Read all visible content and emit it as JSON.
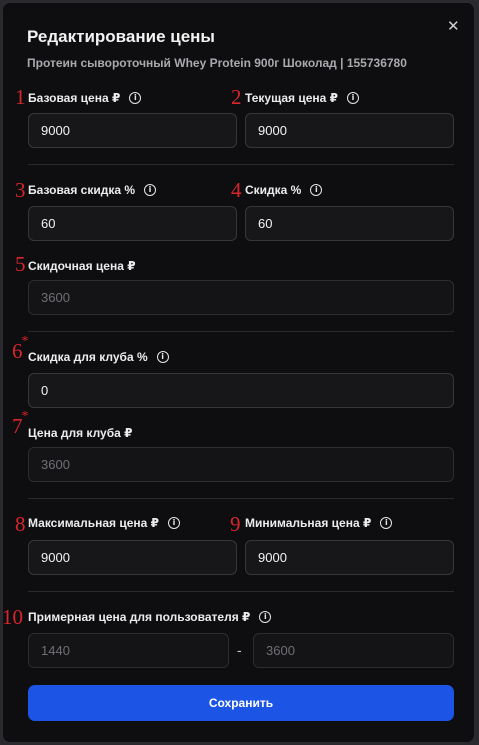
{
  "dialog": {
    "title": "Редактирование цены",
    "subtitle": "Протеин сывороточный Whey Protein 900г Шоколад | 155736780",
    "close_icon": "close-icon"
  },
  "fields": {
    "base_price": {
      "marker": "1",
      "label": "Базовая цена ₽",
      "value": "9000"
    },
    "current_price": {
      "marker": "2",
      "label": "Текущая цена ₽",
      "value": "9000"
    },
    "base_discount": {
      "marker": "3",
      "label": "Базовая скидка %",
      "value": "60"
    },
    "discount": {
      "marker": "4",
      "label": "Скидка %",
      "value": "60"
    },
    "discount_price": {
      "marker": "5",
      "label": "Скидочная цена ₽",
      "value": "3600"
    },
    "club_discount": {
      "marker": "6",
      "star": "*",
      "label": "Скидка для клуба %",
      "value": "0"
    },
    "club_price": {
      "marker": "7",
      "star": "*",
      "label": "Цена для клуба ₽",
      "value": "3600"
    },
    "max_price": {
      "marker": "8",
      "label": "Максимальная цена ₽",
      "value": "9000"
    },
    "min_price": {
      "marker": "9",
      "label": "Минимальная цена ₽",
      "value": "9000"
    },
    "user_price": {
      "marker": "10",
      "label": "Примерная цена для пользователя ₽",
      "from": "1440",
      "separator": "-",
      "to": "3600"
    }
  },
  "info_icon": "info-icon",
  "save_label": "Сохранить",
  "colors": {
    "accent": "#1c55e6",
    "marker": "#d8262b",
    "background": "#0e0e10"
  }
}
